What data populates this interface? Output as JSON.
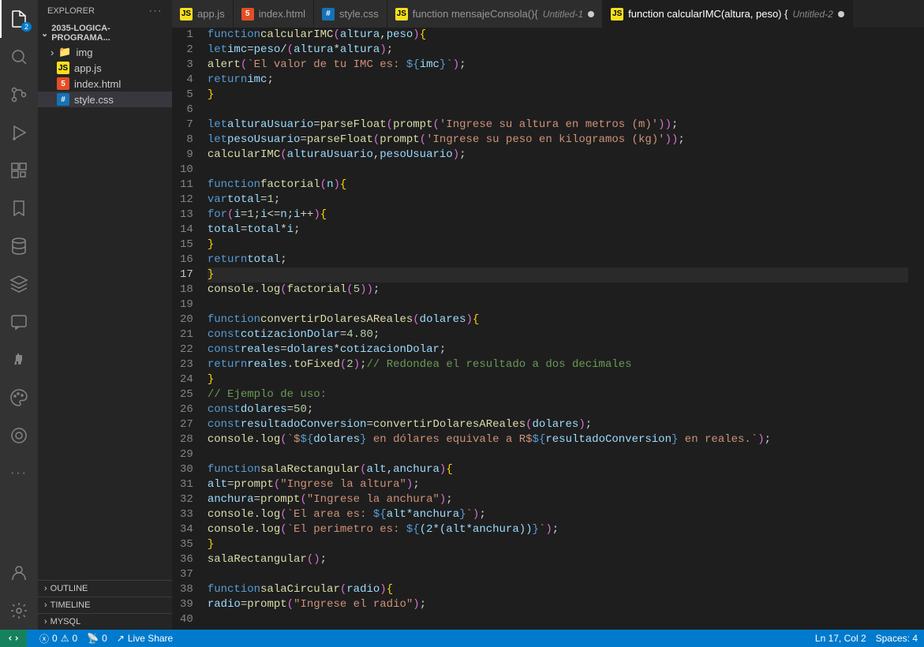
{
  "sidebar": {
    "title": "EXPLORER",
    "folder_name": "2035-LOGICA-PROGRAMA...",
    "items": [
      {
        "name": "img",
        "type": "folder"
      },
      {
        "name": "app.js",
        "type": "js"
      },
      {
        "name": "index.html",
        "type": "html"
      },
      {
        "name": "style.css",
        "type": "css",
        "selected": true
      }
    ],
    "collapsed": [
      "OUTLINE",
      "TIMELINE",
      "MYSQL"
    ]
  },
  "activity_badge": "2",
  "tabs": [
    {
      "label": "app.js",
      "icon": "js"
    },
    {
      "label": "index.html",
      "icon": "html"
    },
    {
      "label": "style.css",
      "icon": "css"
    },
    {
      "label": "function mensajeConsola(){",
      "icon": "js",
      "suffix": "Untitled-1",
      "dirty": true
    },
    {
      "label": "function calcularIMC(altura, peso) {",
      "icon": "js",
      "suffix": "Untitled-2",
      "dirty": true,
      "active": true
    }
  ],
  "code_lines": [
    "function calcularIMC(altura, peso) {",
    "    let imc = peso / (altura * altura);",
    "    alert(`El valor de tu IMC es: ${imc}`);",
    "    return imc;",
    "  }",
    "",
    "  let alturaUsuario = parseFloat(prompt('Ingrese su altura en metros (m)'));",
    "  let pesoUsuario = parseFloat(prompt('Ingrese su peso en kilogramos (kg)'));",
    "  calcularIMC(alturaUsuario, pesoUsuario);",
    "",
    "  function factorial (n) {",
    "    var total = 1;",
    "    for (i=1; i<=n; i++) {",
    "        total = total * i;",
    "    }",
    "    return total;",
    "}",
    "console.log(factorial(5));",
    "",
    "function convertirDolaresAReales(dolares) {",
    "    const cotizacionDolar = 4.80;",
    "    const reales = dolares * cotizacionDolar;",
    "    return reales.toFixed(2); // Redondea el resultado a dos decimales",
    "  }",
    "  ",
    "  // Ejemplo de uso:",
    "  const dolares = 50;",
    "  const resultadoConversion = convertirDolaresAReales(dolares);",
    "  console.log(`$${dolares} en dólares equivale a R$${resultadoConversion} en reales.`);",
    "",
    "function salaRectangular(alt,anchura) {",
    "    alt = prompt(\"Ingrese la altura\");",
    "    anchura = prompt(\"Ingrese la anchura\");",
    "    console.log(`El area es: ${alt*anchura}`);",
    "    console.log(`El perimetro es: ${(2*(alt*anchura))}`);",
    "  }",
    "  salaRectangular();",
    "",
    "  function salaCircular(radio) {",
    "    radio = prompt(\"Ingrese el radio\");"
  ],
  "status": {
    "errors": "0",
    "warnings": "0",
    "ports": "0",
    "live_share": "Live Share",
    "cursor": "Ln 17, Col 2",
    "spaces": "Spaces: 4"
  }
}
